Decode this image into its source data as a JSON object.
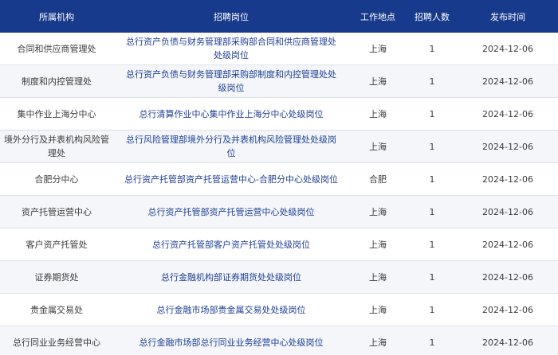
{
  "table": {
    "headers": [
      "所属机构",
      "招聘岗位",
      "工作地点",
      "招聘人数",
      "发布时间"
    ],
    "rows": [
      {
        "dept": "合同和供应商管理处",
        "post": "总行资产负债与财务管理部采购部合同和供应商管理处处级岗位",
        "location": "上海",
        "count": "1",
        "date": "2024-12-06"
      },
      {
        "dept": "制度和内控管理处",
        "post": "总行资产负债与财务管理部采购部制度和内控管理处处级岗位",
        "location": "上海",
        "count": "1",
        "date": "2024-12-06"
      },
      {
        "dept": "集中作业上海分中心",
        "post": "总行清算作业中心集中作业上海分中心处级岗位",
        "location": "上海",
        "count": "1",
        "date": "2024-12-06"
      },
      {
        "dept": "境外分行及并表机构风险管理处",
        "post": "总行风险管理部境外分行及并表机构风险管理处处级岗位",
        "location": "上海",
        "count": "1",
        "date": "2024-12-06"
      },
      {
        "dept": "合肥分中心",
        "post": "总行资产托管部资产托管运营中心-合肥分中心处级岗位",
        "location": "合肥",
        "count": "1",
        "date": "2024-12-06"
      },
      {
        "dept": "资产托管运营中心",
        "post": "总行资产托管部资产托管运营中心处级岗位",
        "location": "上海",
        "count": "1",
        "date": "2024-12-06"
      },
      {
        "dept": "客户资产托管处",
        "post": "总行资产托管部客户资产托管处处级岗位",
        "location": "上海",
        "count": "1",
        "date": "2024-12-06"
      },
      {
        "dept": "证券期货处",
        "post": "总行金融机构部证券期货处处级岗位",
        "location": "上海",
        "count": "1",
        "date": "2024-12-06"
      },
      {
        "dept": "贵金属交易处",
        "post": "总行金融市场部贵金属交易处处级岗位",
        "location": "上海",
        "count": "1",
        "date": "2024-12-06"
      },
      {
        "dept": "总行同业业务经营中心",
        "post": "总行金融市场部总行同业业务经营中心处级岗位",
        "location": "上海",
        "count": "1",
        "date": "2024-12-06"
      }
    ]
  },
  "colors": {
    "header_bg": "#173a8c",
    "header_text": "#ffffff",
    "link": "#1f3f96",
    "row_alt": "#f4f6f9"
  }
}
